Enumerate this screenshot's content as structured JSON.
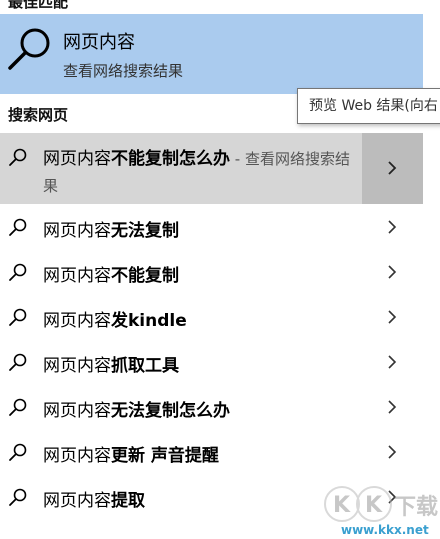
{
  "top_cut_title": "最佳匹配",
  "best_match": {
    "title": "网页内容",
    "subtitle": "查看网络搜索结果"
  },
  "section_title": "搜索网页",
  "tooltip": "预览 Web 结果(向右",
  "selected": {
    "prefix": "网页内容",
    "bold": "不能复制怎么办",
    "suffix": " - 查看网络搜索结果"
  },
  "suggestions": [
    {
      "prefix": "网页内容",
      "bold": "无法复制"
    },
    {
      "prefix": "网页内容",
      "bold": "不能复制"
    },
    {
      "prefix": "网页内容",
      "bold": "发kindle"
    },
    {
      "prefix": "网页内容",
      "bold": "抓取工具"
    },
    {
      "prefix": "网页内容",
      "bold": "无法复制怎么办"
    },
    {
      "prefix": "网页内容",
      "bold": "更新 声音提醒"
    },
    {
      "prefix": "网页内容",
      "bold": "提取"
    }
  ],
  "watermark": {
    "logo": "KK下载",
    "url": "www.kkx.net"
  },
  "colors": {
    "best_match_bg": "#aacbee",
    "selected_bg": "#d6d6d6",
    "arrow_box_bg": "#bcbcbc"
  }
}
